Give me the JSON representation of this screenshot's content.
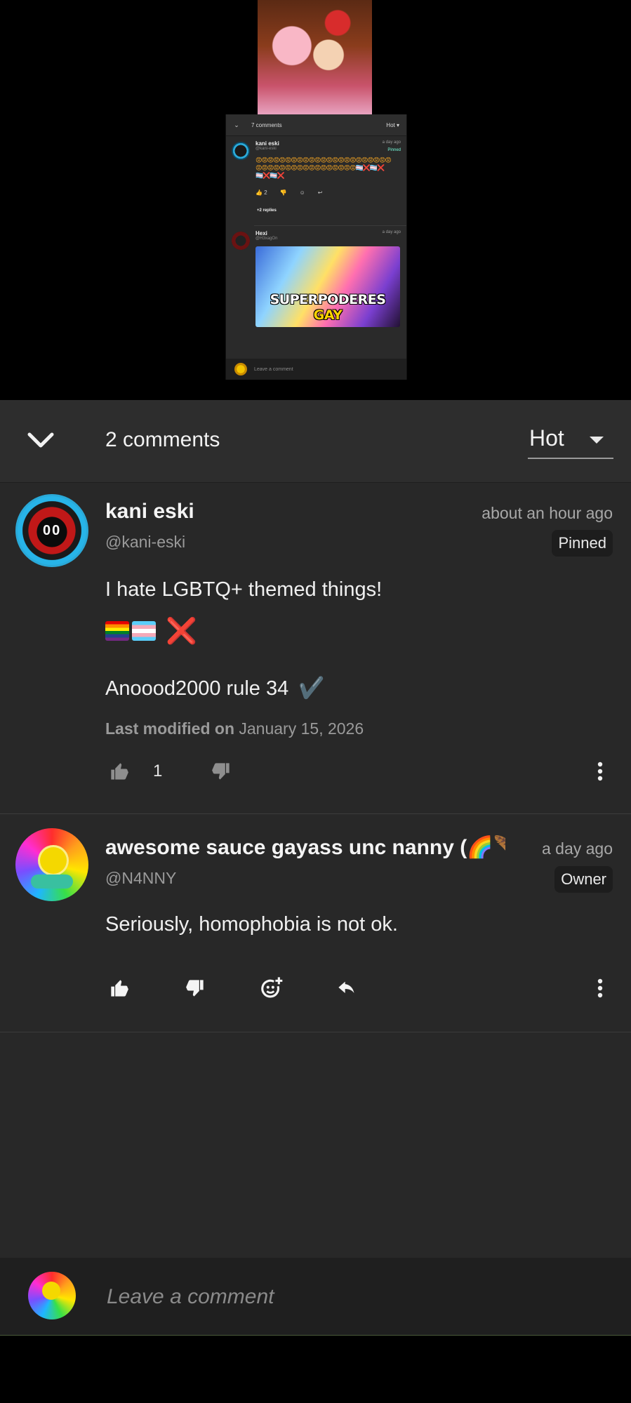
{
  "preview": {
    "comments_count": "7 comments",
    "sort": "Hot",
    "c1_name": "kani eski",
    "c1_handle": "@kani-eski",
    "c1_time": "a day ago",
    "c1_badge": "Pinned",
    "c1_emojis": "😡😡😡😡😡😡😡😡😡😡😡😡😡😡😡😡😡😡😡😡😡😡😡😡😡😡😡😡😡😡😡😡😡😡😡😡😡😡😡😡🏳️‍⚧️❌🏳️‍⚧️❌🏳️‍⚧️❌🏳️‍⚧️❌",
    "c1_likes": "2",
    "replies": "+2 replies",
    "c2_name": "Hexi",
    "c2_handle": "@H3xagOn",
    "c2_time": "a day ago",
    "meme_text_1": "SUPERPODERES ",
    "meme_text_2": "GAY",
    "leave": "Leave a comment"
  },
  "header": {
    "count": "2 comments",
    "sort_label": "Hot"
  },
  "comments": [
    {
      "name": "kani eski",
      "handle": "@kani-eski",
      "time": "about an hour ago",
      "badge": "Pinned",
      "line1": "I hate LGBTQ+ themed things!",
      "line3": "Anoood2000 rule 34",
      "check": "✔️",
      "cross": "❌",
      "modified_label": "Last modified on",
      "modified_date": "January 15, 2026",
      "likes": "1"
    },
    {
      "name": "awesome sauce gayass unc nanny (🌈🪶",
      "handle": "@N4NNY",
      "time": "a day ago",
      "badge": "Owner",
      "line1": "Seriously, homophobia is not ok."
    }
  ],
  "composer": {
    "placeholder": "Leave a comment"
  },
  "colors": {
    "panel_bg": "#282828",
    "header_bg": "#2d2d2d",
    "composer_bg": "#1f1f1f"
  }
}
